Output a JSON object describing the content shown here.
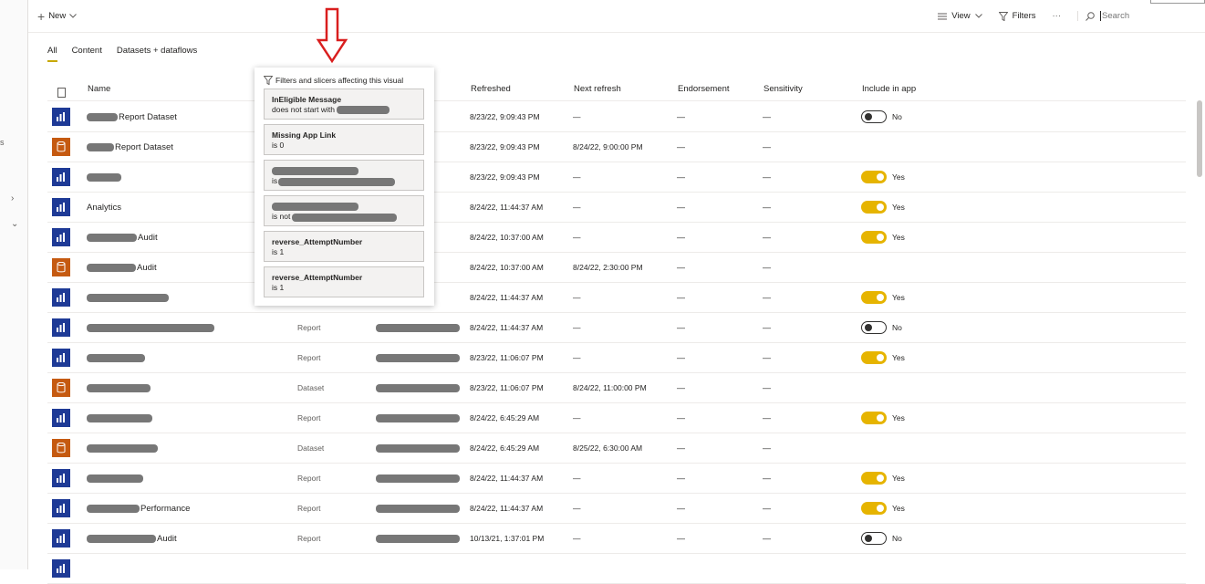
{
  "toolbar": {
    "new_label": "New",
    "view_label": "View",
    "filters_label": "Filters",
    "more_label": "···",
    "search_placeholder": "Search"
  },
  "left_rail": {
    "partial_text": "s"
  },
  "tabs": [
    {
      "label": "All",
      "active": true
    },
    {
      "label": "Content",
      "active": false
    },
    {
      "label": "Datasets + dataflows",
      "active": false
    }
  ],
  "columns": {
    "name": "Name",
    "refreshed": "Refreshed",
    "next_refresh": "Next refresh",
    "endorsement": "Endorsement",
    "sensitivity": "Sensitivity",
    "include_in_app": "Include in app"
  },
  "rows": [
    {
      "icon": "report",
      "name": "Report Dataset",
      "type": "",
      "refreshed": "8/23/22, 9:09:43 PM",
      "next_refresh": "—",
      "endorsement": "—",
      "sensitivity": "—",
      "include": "No",
      "toggle": "off"
    },
    {
      "icon": "dataset",
      "name": "Report Dataset",
      "type": "",
      "refreshed": "8/23/22, 9:09:43 PM",
      "next_refresh": "8/24/22, 9:00:00 PM",
      "endorsement": "—",
      "sensitivity": "—",
      "include": "",
      "toggle": "none"
    },
    {
      "icon": "report",
      "name": "",
      "type": "",
      "refreshed": "8/23/22, 9:09:43 PM",
      "next_refresh": "—",
      "endorsement": "—",
      "sensitivity": "—",
      "include": "Yes",
      "toggle": "on"
    },
    {
      "icon": "report",
      "name": "Analytics",
      "type": "",
      "refreshed": "8/24/22, 11:44:37 AM",
      "next_refresh": "—",
      "endorsement": "—",
      "sensitivity": "—",
      "include": "Yes",
      "toggle": "on"
    },
    {
      "icon": "report",
      "name": "Audit",
      "type": "",
      "refreshed": "8/24/22, 10:37:00 AM",
      "next_refresh": "—",
      "endorsement": "—",
      "sensitivity": "—",
      "include": "Yes",
      "toggle": "on"
    },
    {
      "icon": "dataset",
      "name": "Audit",
      "type": "",
      "refreshed": "8/24/22, 10:37:00 AM",
      "next_refresh": "8/24/22, 2:30:00 PM",
      "endorsement": "—",
      "sensitivity": "—",
      "include": "",
      "toggle": "none"
    },
    {
      "icon": "report",
      "name": "",
      "type": "",
      "refreshed": "8/24/22, 11:44:37 AM",
      "next_refresh": "—",
      "endorsement": "—",
      "sensitivity": "—",
      "include": "Yes",
      "toggle": "on"
    },
    {
      "icon": "report",
      "name": "",
      "type": "Report",
      "refreshed": "8/24/22, 11:44:37 AM",
      "next_refresh": "—",
      "endorsement": "—",
      "sensitivity": "—",
      "include": "No",
      "toggle": "off"
    },
    {
      "icon": "report",
      "name": "",
      "type": "Report",
      "refreshed": "8/23/22, 11:06:07 PM",
      "next_refresh": "—",
      "endorsement": "—",
      "sensitivity": "—",
      "include": "Yes",
      "toggle": "on"
    },
    {
      "icon": "dataset",
      "name": "",
      "type": "Dataset",
      "refreshed": "8/23/22, 11:06:07 PM",
      "next_refresh": "8/24/22, 11:00:00 PM",
      "endorsement": "—",
      "sensitivity": "—",
      "include": "",
      "toggle": "none"
    },
    {
      "icon": "report",
      "name": "",
      "type": "Report",
      "refreshed": "8/24/22, 6:45:29 AM",
      "next_refresh": "—",
      "endorsement": "—",
      "sensitivity": "—",
      "include": "Yes",
      "toggle": "on"
    },
    {
      "icon": "dataset",
      "name": "",
      "type": "Dataset",
      "refreshed": "8/24/22, 6:45:29 AM",
      "next_refresh": "8/25/22, 6:30:00 AM",
      "endorsement": "—",
      "sensitivity": "—",
      "include": "",
      "toggle": "none"
    },
    {
      "icon": "report",
      "name": "",
      "type": "Report",
      "refreshed": "8/24/22, 11:44:37 AM",
      "next_refresh": "—",
      "endorsement": "—",
      "sensitivity": "—",
      "include": "Yes",
      "toggle": "on"
    },
    {
      "icon": "report",
      "name": "Performance",
      "type": "Report",
      "refreshed": "8/24/22, 11:44:37 AM",
      "next_refresh": "—",
      "endorsement": "—",
      "sensitivity": "—",
      "include": "Yes",
      "toggle": "on"
    },
    {
      "icon": "report",
      "name": "Audit",
      "type": "Report",
      "refreshed": "10/13/21, 1:37:01 PM",
      "next_refresh": "—",
      "endorsement": "—",
      "sensitivity": "—",
      "include": "No",
      "toggle": "off"
    }
  ],
  "popup": {
    "title": "Filters and slicers affecting this visual",
    "filters": [
      {
        "label": "InEligible Message",
        "condition": "does not start with"
      },
      {
        "label": "Missing App Link",
        "condition": "is 0"
      },
      {
        "label": "",
        "condition": "is"
      },
      {
        "label": "",
        "condition": "is not"
      },
      {
        "label": "reverse_AttemptNumber",
        "condition": "is 1"
      },
      {
        "label": "reverse_AttemptNumber",
        "condition": "is 1"
      }
    ]
  },
  "colors": {
    "report_icon": "#1e3a96",
    "dataset_icon": "#c55a11",
    "toggle_on": "#e6b400",
    "arrow": "#d91e1e"
  }
}
